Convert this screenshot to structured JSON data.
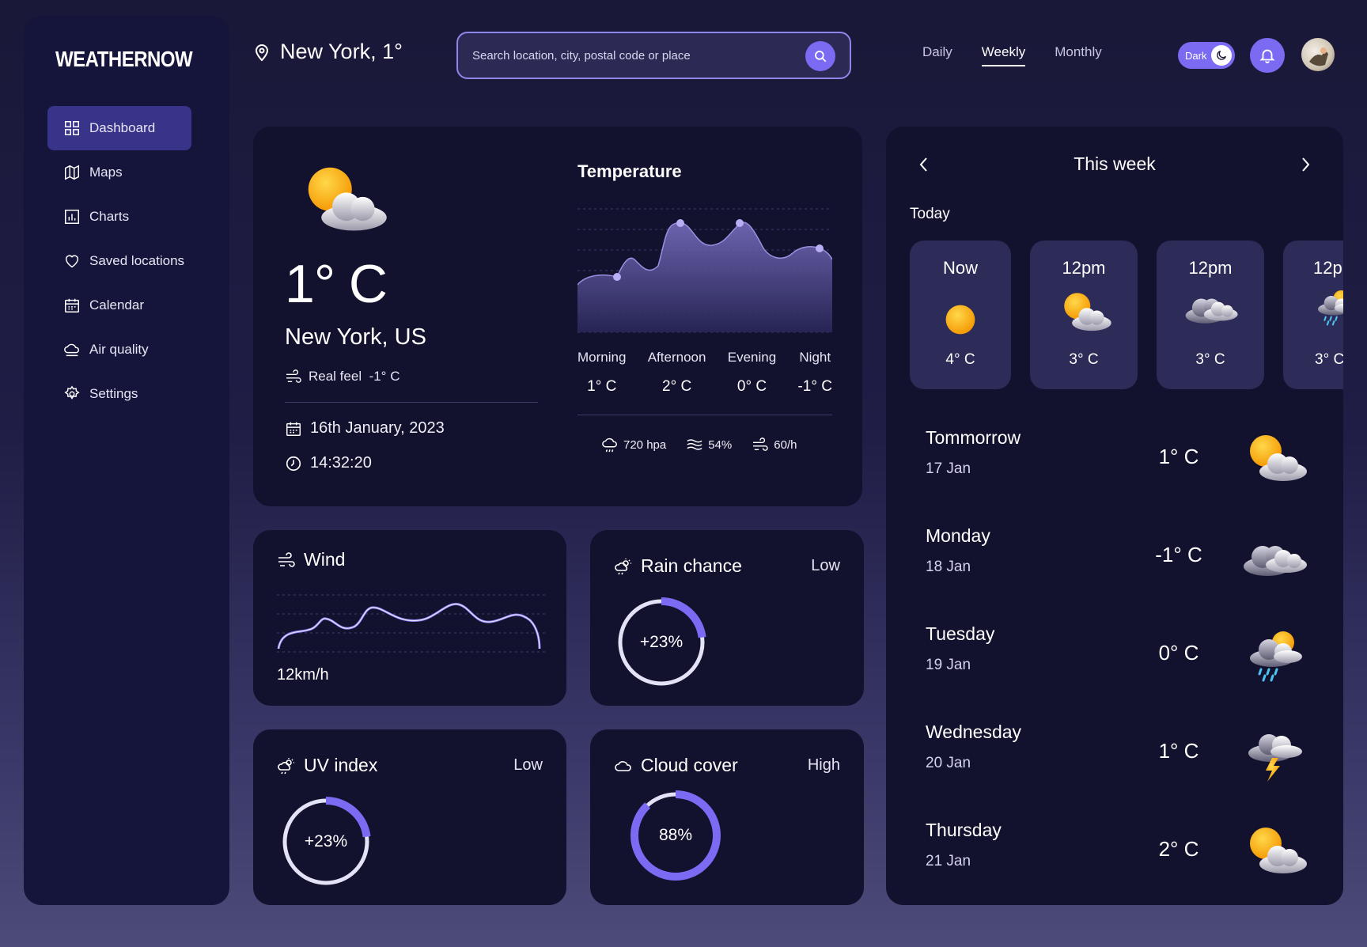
{
  "app": {
    "logo": "WEATHERNOW"
  },
  "sidebar": {
    "items": [
      {
        "label": "Dashboard",
        "icon": "dashboard-icon",
        "active": true
      },
      {
        "label": "Maps",
        "icon": "map-icon"
      },
      {
        "label": "Charts",
        "icon": "chart-icon"
      },
      {
        "label": "Saved locations",
        "icon": "heart-icon"
      },
      {
        "label": "Calendar",
        "icon": "calendar-icon"
      },
      {
        "label": "Air quality",
        "icon": "air-quality-icon"
      },
      {
        "label": "Settings",
        "icon": "gear-icon"
      }
    ]
  },
  "header": {
    "location": "New York, 1°",
    "search_placeholder": "Search location, city, postal code or place",
    "tabs": [
      "Daily",
      "Weekly",
      "Monthly"
    ],
    "active_tab": "Weekly",
    "theme_label": "Dark"
  },
  "current": {
    "temp": "1° C",
    "city": "New York, US",
    "real_feel_label": "Real feel",
    "real_feel_value": "-1° C",
    "date": "16th January, 2023",
    "time": "14:32:20"
  },
  "temperature": {
    "title": "Temperature",
    "periods": [
      {
        "label": "Morning",
        "value": "1° C"
      },
      {
        "label": "Afternoon",
        "value": "2° C"
      },
      {
        "label": "Evening",
        "value": "0° C"
      },
      {
        "label": "Night",
        "value": "-1° C"
      }
    ],
    "stats": {
      "pressure": "720 hpa",
      "humidity": "54%",
      "wind": "60/h"
    }
  },
  "wind": {
    "title": "Wind",
    "value": "12km/h"
  },
  "rain": {
    "title": "Rain chance",
    "level": "Low",
    "value": "+23%",
    "fraction": 0.23
  },
  "uv": {
    "title": "UV index",
    "level": "Low",
    "value": "+23%",
    "fraction": 0.23
  },
  "cloud": {
    "title": "Cloud cover",
    "level": "High",
    "value": "88%",
    "fraction": 0.88
  },
  "week": {
    "title": "This week",
    "today_label": "Today",
    "hours": [
      {
        "time": "Now",
        "temp": "4° C",
        "icon": "sun-icon"
      },
      {
        "time": "12pm",
        "temp": "3° C",
        "icon": "partly-cloudy-icon"
      },
      {
        "time": "12pm",
        "temp": "3° C",
        "icon": "cloudy-icon"
      },
      {
        "time": "12p",
        "temp": "3° C",
        "icon": "rain-icon"
      }
    ],
    "days": [
      {
        "name": "Tommorrow",
        "date": "17 Jan",
        "temp": "1° C",
        "icon": "partly-cloudy-icon"
      },
      {
        "name": "Monday",
        "date": "18 Jan",
        "temp": "-1° C",
        "icon": "cloudy-icon"
      },
      {
        "name": "Tuesday",
        "date": "19 Jan",
        "temp": "0° C",
        "icon": "rain-icon"
      },
      {
        "name": "Wednesday",
        "date": "20 Jan",
        "temp": "1° C",
        "icon": "thunderstorm-icon"
      },
      {
        "name": "Thursday",
        "date": "21 Jan",
        "temp": "2° C",
        "icon": "partly-cloudy-icon"
      }
    ]
  },
  "colors": {
    "accent": "#7b6bf3",
    "panel": "#12112e",
    "sun": "#f9b00c"
  }
}
